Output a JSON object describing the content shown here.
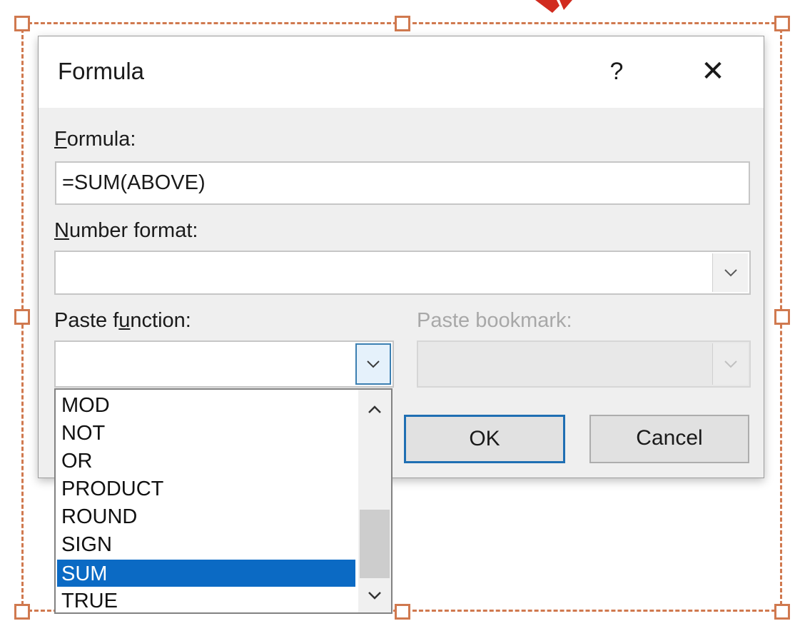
{
  "dialog": {
    "title": "Formula",
    "help_label": "?",
    "close_label": "✕"
  },
  "formula": {
    "label_accesskey": "F",
    "label_rest": "ormula:",
    "value": "=SUM(ABOVE)"
  },
  "number_format": {
    "label_accesskey": "N",
    "label_rest": "umber format:",
    "value": ""
  },
  "paste_function": {
    "label_before": "Paste f",
    "label_accesskey": "u",
    "label_after": "nction:",
    "value": "",
    "options": [
      "MOD",
      "NOT",
      "OR",
      "PRODUCT",
      "ROUND",
      "SIGN",
      "SUM",
      "TRUE"
    ],
    "selected": "SUM"
  },
  "paste_bookmark": {
    "label": "Paste bookmark:",
    "value": ""
  },
  "buttons": {
    "ok": "OK",
    "cancel": "Cancel"
  },
  "colors": {
    "selection_frame": "#d0794f",
    "selected_item": "#0b6ac4",
    "default_button_border": "#1f6fb3"
  },
  "icons": {
    "help": "question-mark-icon",
    "close": "close-x-icon",
    "dropdown": "chevron-down-icon",
    "scroll_up": "chevron-up-icon",
    "scroll_down": "chevron-down-icon"
  }
}
